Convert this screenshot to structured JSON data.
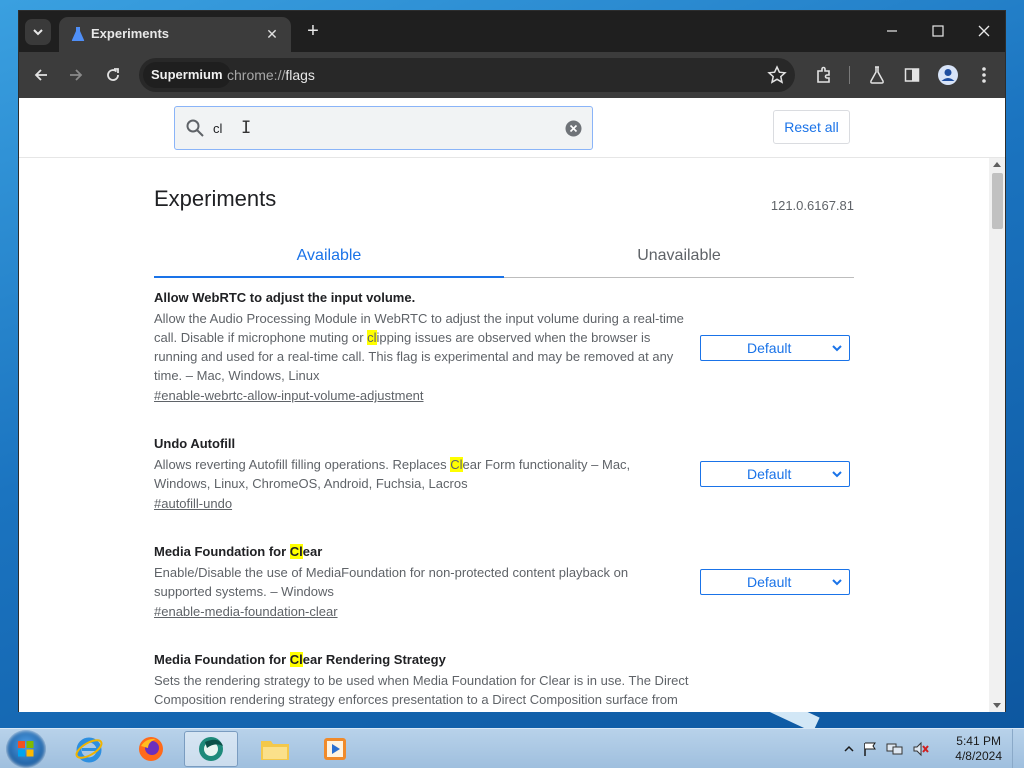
{
  "browser": {
    "tab_title": "Experiments",
    "site_chip": "Supermium",
    "url_scheme": "chrome://",
    "url_path": "flags"
  },
  "search": {
    "value": "cl",
    "reset_label": "Reset all"
  },
  "page": {
    "title": "Experiments",
    "version": "121.0.6167.81",
    "tabs": [
      "Available",
      "Unavailable"
    ]
  },
  "experiments": [
    {
      "title": "Allow WebRTC to adjust the input volume.",
      "desc_before": "Allow the Audio Processing Module in WebRTC to adjust the input volume during a real-time call. Disable if microphone muting or ",
      "desc_match": "cl",
      "desc_after": "ipping issues are observed when the browser is running and used for a real-time call. This flag is experimental and may be removed at any time. – Mac, Windows, Linux",
      "link": "#enable-webrtc-allow-input-volume-adjustment",
      "select_value": "Default"
    },
    {
      "title": "Undo Autofill",
      "desc_before": "Allows reverting Autofill filling operations. Replaces ",
      "desc_match": "Cl",
      "desc_after": "ear Form functionality – Mac, Windows, Linux, ChromeOS, Android, Fuchsia, Lacros",
      "link": "#autofill-undo",
      "select_value": "Default"
    },
    {
      "title_before": "Media Foundation for ",
      "title_match": "Cl",
      "title_after": "ear",
      "desc": "Enable/Disable the use of MediaFoundation for non-protected content playback on supported systems. – Windows",
      "link": "#enable-media-foundation-clear",
      "select_value": "Default"
    },
    {
      "title_before": "Media Foundation for ",
      "title_match": "Cl",
      "title_after": "ear Rendering Strategy",
      "desc": "Sets the rendering strategy to be used when Media Foundation for Clear is in use. The Direct Composition rendering strategy enforces presentation to a Direct Composition surface from the Media Foundation Media Engine. The Frame Server rendering strategy produces video"
    }
  ],
  "taskbar": {
    "time": "5:41 PM",
    "date": "4/8/2024"
  }
}
